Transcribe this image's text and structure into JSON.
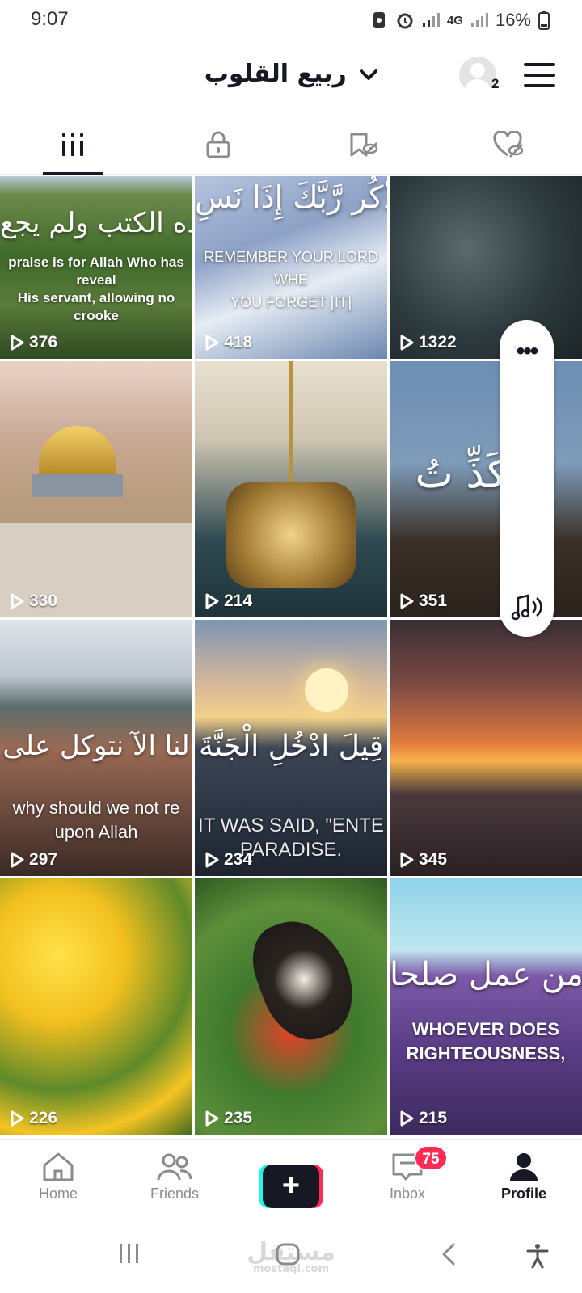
{
  "status": {
    "time": "9:07",
    "network": "4G",
    "battery": "16%"
  },
  "header": {
    "username": "ربيع القلوب",
    "follower_requests": "2"
  },
  "tabs": [
    {
      "icon": "videos-grid-icon",
      "active": true
    },
    {
      "icon": "private-lock-icon",
      "active": false
    },
    {
      "icon": "reposts-hidden-icon",
      "active": false
    },
    {
      "icon": "liked-hidden-icon",
      "active": false
    }
  ],
  "videos": [
    {
      "views": "376",
      "overlay": "نزل على عبده الكتب ولم يجع",
      "caption": "praise is for Allah Who has reveal\nHis servant, allowing no crooke",
      "bg": "forest"
    },
    {
      "views": "418",
      "overlay": "وَاذْكُر رَّبَّكَ إِذَا نَسِ",
      "caption": "REMEMBER YOUR LORD WHE\nYOU FORGET [IT]",
      "bg": "ice"
    },
    {
      "views": "1322",
      "overlay": "",
      "caption": "",
      "bg": "rain"
    },
    {
      "views": "330",
      "overlay": "",
      "caption": "",
      "bg": "dome"
    },
    {
      "views": "214",
      "overlay": "",
      "caption": "",
      "bg": "lamp"
    },
    {
      "views": "351",
      "overlay": "الْمُكَذِّ تُ",
      "caption": "",
      "bg": "tree"
    },
    {
      "views": "297",
      "overlay": "لنا الآ نتوكل على",
      "caption": "why should we not re\nupon Allah",
      "bg": "rocks"
    },
    {
      "views": "234",
      "overlay": "قِيلَ ادْخُلِ الْجَنَّةَ",
      "caption": "IT WAS SAID, \"ENTE\nPARADISE.",
      "bg": "sunset-sea"
    },
    {
      "views": "345",
      "overlay": "",
      "caption": "",
      "bg": "beach"
    },
    {
      "views": "226",
      "overlay": "",
      "caption": "",
      "bg": "flowers"
    },
    {
      "views": "235",
      "overlay": "",
      "caption": "",
      "bg": "butterfly"
    },
    {
      "views": "215",
      "overlay": "من عمل صلحا",
      "caption": "WHOEVER DOES\nRIGHTEOUSNESS,",
      "bg": "lavender"
    }
  ],
  "nav": {
    "home": "Home",
    "friends": "Friends",
    "inbox": "Inbox",
    "inbox_badge": "75",
    "profile": "Profile"
  },
  "watermark": {
    "arabic": "مستقل",
    "url": "mostaql.com"
  }
}
